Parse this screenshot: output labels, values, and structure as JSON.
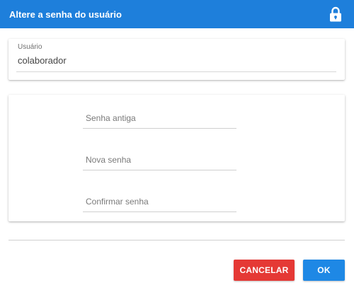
{
  "dialog": {
    "title": "Altere a senha do usuário",
    "header_icon": "lock-icon",
    "colors": {
      "header": "#1e7fdb",
      "cancel": "#e53935",
      "ok": "#1e88e5"
    }
  },
  "user_field": {
    "label": "Usuário",
    "value": "colaborador"
  },
  "password_fields": {
    "old_placeholder": "Senha antiga",
    "new_placeholder": "Nova senha",
    "confirm_placeholder": "Confirmar senha"
  },
  "actions": {
    "cancel_label": "CANCELAR",
    "ok_label": "OK"
  }
}
